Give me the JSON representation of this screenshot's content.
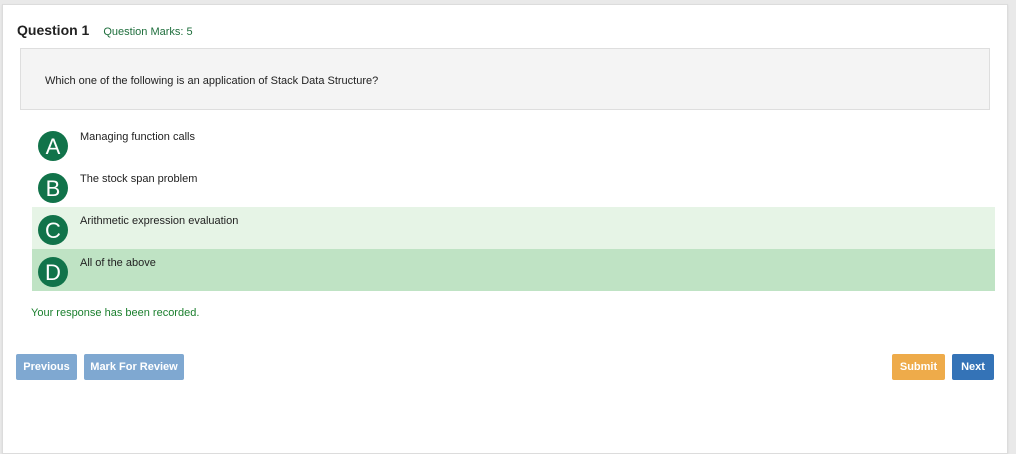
{
  "question": {
    "title": "Question 1",
    "marks": "Question Marks: 5",
    "text": "Which one of the following is an application of Stack Data Structure?"
  },
  "options": [
    {
      "letter": "A",
      "text": "Managing function calls"
    },
    {
      "letter": "B",
      "text": "The stock span problem"
    },
    {
      "letter": "C",
      "text": "Arithmetic expression evaluation"
    },
    {
      "letter": "D",
      "text": "All of the above"
    }
  ],
  "status_message": "Your response has been recorded.",
  "buttons": {
    "previous": "Previous",
    "mark_for_review": "Mark For Review",
    "submit": "Submit",
    "next": "Next"
  },
  "colors": {
    "accent_green": "#11734a",
    "hover_highlight": "#e6f4e6",
    "selected_highlight": "#bfe3c4",
    "primary_blue": "#3473b7",
    "submit_orange": "#eeab4a"
  }
}
